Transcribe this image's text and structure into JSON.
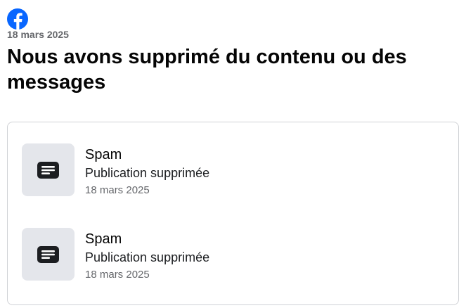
{
  "header": {
    "logo_icon": "facebook-logo-icon",
    "date": "18 mars 2025",
    "title": "Nous avons supprimé du contenu ou des messages"
  },
  "items": [
    {
      "type": "Spam",
      "status": "Publication supprimée",
      "date": "18 mars 2025",
      "icon": "post-icon"
    },
    {
      "type": "Spam",
      "status": "Publication supprimée",
      "date": "18 mars 2025",
      "icon": "post-icon"
    }
  ],
  "colors": {
    "brand": "#0866ff",
    "thumb_bg": "#e4e6eb",
    "secondary_text": "#65676b",
    "border": "#d0d2d6"
  }
}
